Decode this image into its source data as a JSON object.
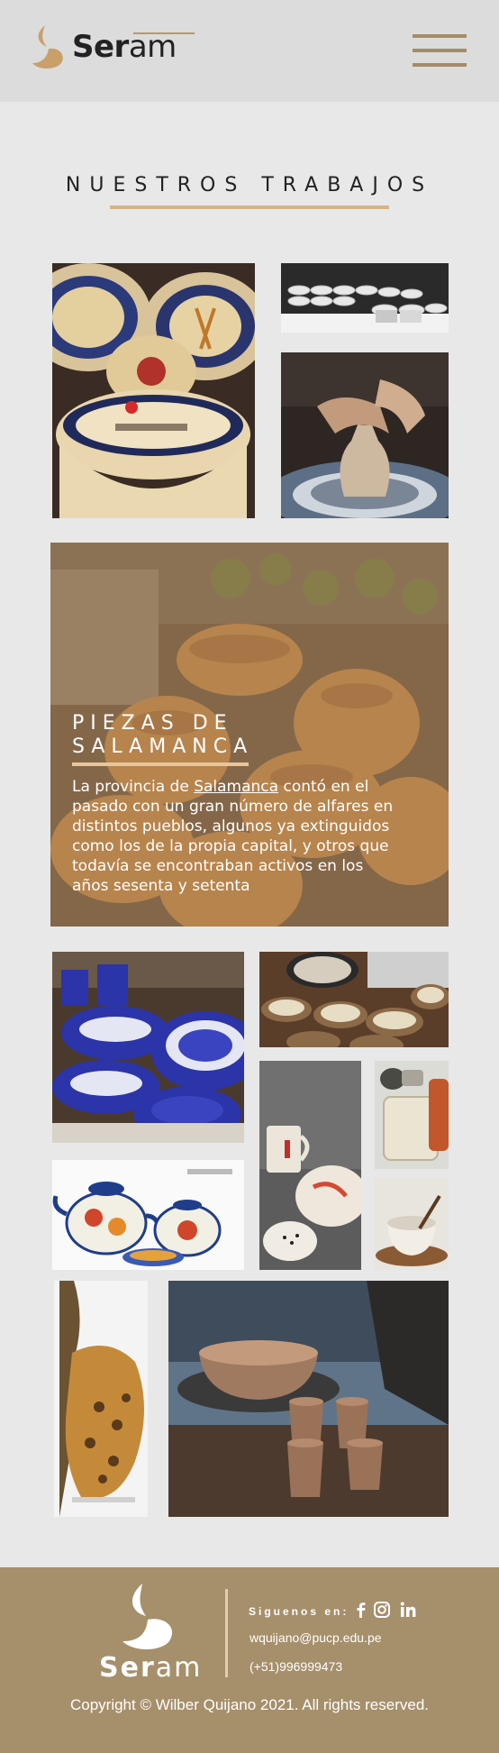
{
  "brand": {
    "name_bold": "Ser",
    "name_light": "am",
    "accent_color": "#c9a06a"
  },
  "header": {
    "menu_icon": "hamburger-menu-icon"
  },
  "gallery": {
    "title": "NUESTROS TRABAJOS"
  },
  "feature": {
    "title": "PIEZAS DE SALAMANCA",
    "text_before": "La provincia de ",
    "link_text": "Salamanca",
    "text_after": " contó en el pasado con un gran número de alfares en distintos pueblos, algunos ya extinguidos como los de la propia capital, y otros que todavía se encontraban activos en los años sesenta y setenta"
  },
  "footer": {
    "follow_label": "Siguenos en:",
    "social_icons": [
      "facebook-icon",
      "instagram-icon",
      "linkedin-icon"
    ],
    "email": "wquijano@pucp.edu.pe",
    "phone": "(+51)996999473",
    "copyright": "Copyright © Wilber Quijano 2021. All rights reserved.",
    "logo_bold": "Ser",
    "logo_light": "am"
  }
}
